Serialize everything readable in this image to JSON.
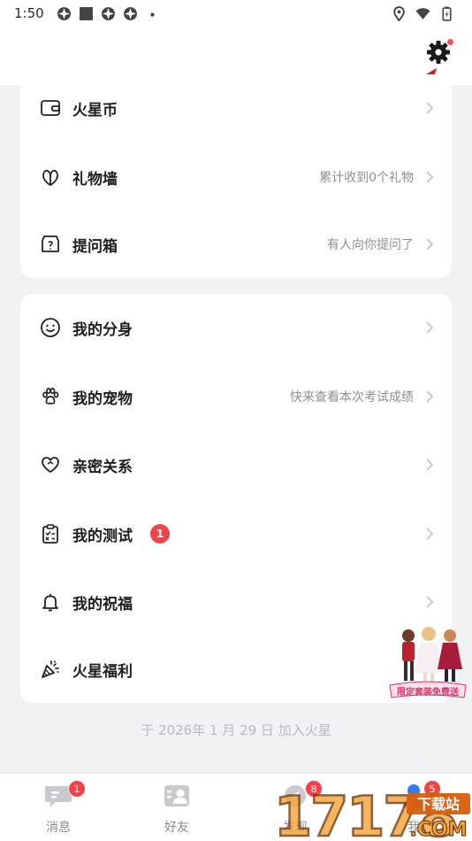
{
  "status_bar": {
    "time": "1:50"
  },
  "card1": [
    {
      "icon": "wallet-icon",
      "label": "火星币",
      "hint": ""
    },
    {
      "icon": "gift-wall-icon",
      "label": "礼物墙",
      "hint": "累计收到0个礼物"
    },
    {
      "icon": "question-box-icon",
      "label": "提问箱",
      "hint": "有人向你提问了"
    }
  ],
  "card2": [
    {
      "icon": "smile-icon",
      "label": "我的分身",
      "hint": ""
    },
    {
      "icon": "paw-icon",
      "label": "我的宠物",
      "hint": "快来查看本次考试成绩"
    },
    {
      "icon": "heart-link-icon",
      "label": "亲密关系",
      "hint": ""
    },
    {
      "icon": "clipboard-check-icon",
      "label": "我的测试",
      "hint": "",
      "badge": "1"
    },
    {
      "icon": "bell-wish-icon",
      "label": "我的祝福",
      "hint": ""
    },
    {
      "icon": "party-popper-icon",
      "label": "火星福利",
      "hint": ""
    }
  ],
  "joined_text": "于 2026年 1 月 29 日 加入火星",
  "tabs": [
    {
      "icon": "message-icon",
      "label": "消息",
      "badge": "1"
    },
    {
      "icon": "friends-icon",
      "label": "好友",
      "badge": ""
    },
    {
      "icon": "discover-icon",
      "label": "发现",
      "badge": "8"
    },
    {
      "icon": "me-icon",
      "label": "我",
      "badge": "5"
    }
  ],
  "watermark": {
    "brand": "17178",
    "tag": "下载站",
    "com": ".COM",
    "banner": "限定套装免费送"
  },
  "colors": {
    "accent_red": "#f0434a",
    "arrow_red": "#e0141c",
    "page_bg": "#f2f2f4"
  }
}
